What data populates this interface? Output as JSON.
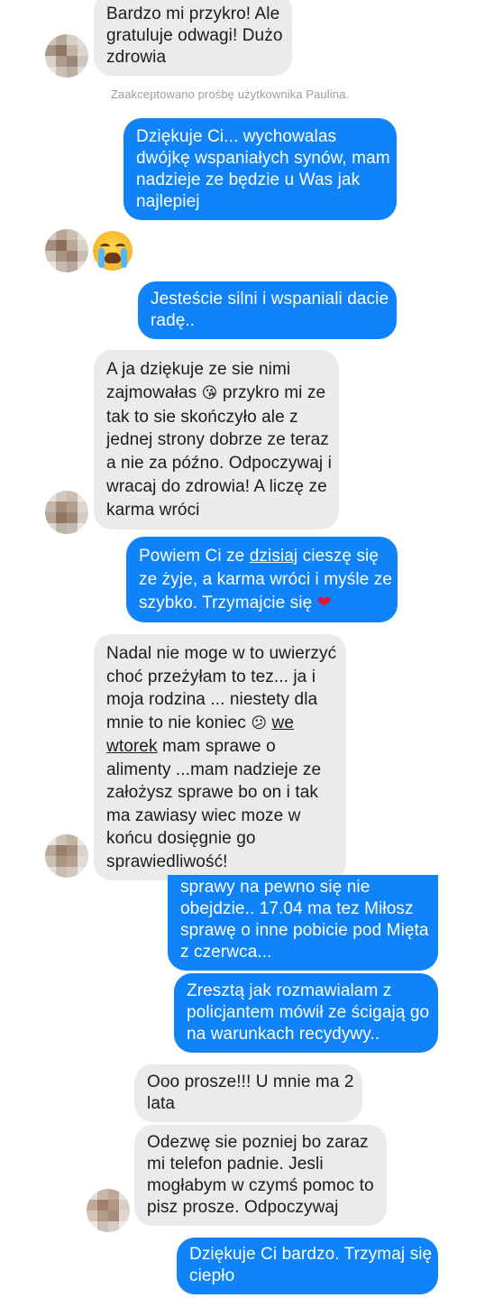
{
  "system": {
    "accepted_request": "Zaakceptowano prośbę użytkownika Paulina."
  },
  "messages": {
    "m1": {
      "l1": "Bardzo mi przykro! Ale",
      "l2": "gratuluje odwagi! Dużo",
      "l3": "zdrowia"
    },
    "m2": {
      "l1": "Dziękuje Ci... wychowalas",
      "l2": "dwójkę wspaniałych synów, mam",
      "l3": "nadzieje ze będzie u Was jak",
      "l4": "najlepiej"
    },
    "m3": {
      "emoji": "😭"
    },
    "m4": {
      "l1": "Jesteście silni i wspaniali dacie",
      "l2": "radę.."
    },
    "m5": {
      "l1": "A ja dziękuje ze sie nimi",
      "l2a": "zajmowałas ",
      "l2emoji": "😘",
      "l2b": " przykro mi ze",
      "l3": "tak to sie skończyło ale z",
      "l4": "jednej strony dobrze ze teraz",
      "l5": "a nie za późno. Odpoczywaj i",
      "l6": "wracaj do zdrowia! A liczę ze",
      "l7": "karma wróci"
    },
    "m6": {
      "l1a": "Powiem Ci ze ",
      "l1link": "dzisiaj",
      "l1b": " cieszę się",
      "l2": "ze żyje, a karma wróci i myśle ze",
      "l3a": "szybko. Trzymajcie się ",
      "l3heart": "❤"
    },
    "m7": {
      "l1": "Nadal nie moge w to uwierzyć",
      "l2": "choć przeżyłam to tez... ja i",
      "l3": "moja rodzina ... niestety dla",
      "l4a": "mnie to nie koniec ",
      "l4emoji": "😕",
      "l4link": "we",
      "l5link": "wtorek",
      "l5b": " mam sprawe o",
      "l6": "alimenty ...mam nadzieje ze",
      "l7": "założysz sprawe bo on i tak",
      "l8": "ma zawiasy wiec moze w",
      "l9": "końcu dosięgnie go",
      "l10": "sprawiedliwość!"
    },
    "m8": {
      "l1": "sprawy na pewno się nie",
      "l2": "obejdzie.. 17.04 ma tez Miłosz",
      "l3": "sprawę o inne pobicie pod Mięta",
      "l4": "z czerwca..."
    },
    "m9": {
      "l1": "Zresztą jak rozmawialam z",
      "l2": "policjantem mówił ze ścigają go",
      "l3": "na warunkach recydywy.."
    },
    "m10": {
      "l1": "Ooo prosze!!! U mnie ma 2",
      "l2": "lata"
    },
    "m11": {
      "l1": "Odezwę sie pozniej bo zaraz",
      "l2": "mi telefon padnie. Jesli",
      "l3": "mogłabym w czymś pomoc to",
      "l4": "pisz prosze. Odpoczywaj"
    },
    "m12": {
      "l1": "Dziękuje Ci bardzo. Trzymaj się",
      "l2": "ciepło"
    }
  },
  "colors": {
    "incoming_bg": "#ebebeb",
    "outgoing_bg": "#0f83f7",
    "incoming_text": "#1c1c1c",
    "outgoing_text": "#ffffff"
  }
}
